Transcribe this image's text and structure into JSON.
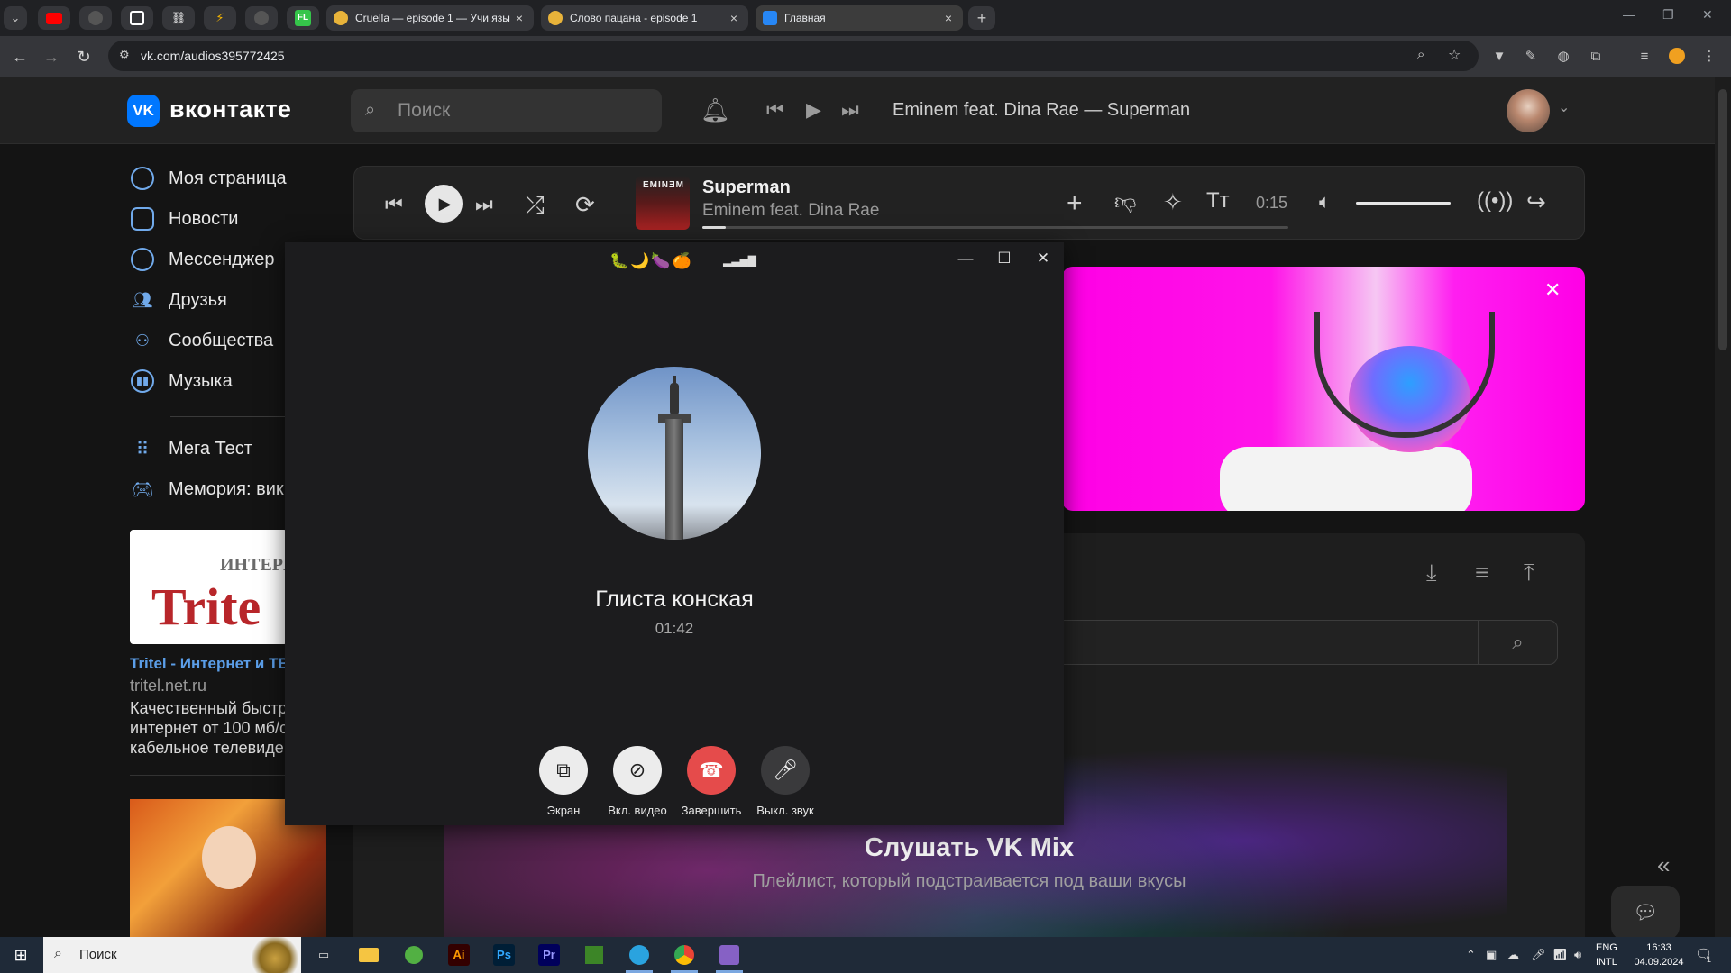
{
  "browser": {
    "tabs": [
      {
        "title": "Cruella — episode 1 — Учи язы",
        "close": "×"
      },
      {
        "title": "Слово пацана - episode 1",
        "close": "×"
      },
      {
        "title": "Главная",
        "close": "×"
      }
    ],
    "new_tab": "+",
    "url": "vk.com/audios395772425"
  },
  "vk": {
    "logo_text": "вконтакте",
    "search_placeholder": "Поиск",
    "header_track": "Eminem feat. Dina Rae — Superman",
    "sidebar": [
      {
        "label": "Моя страница",
        "icon": "user-icon"
      },
      {
        "label": "Новости",
        "icon": "news-icon"
      },
      {
        "label": "Мессенджер",
        "icon": "messenger-icon"
      },
      {
        "label": "Друзья",
        "icon": "friends-icon"
      },
      {
        "label": "Сообщества",
        "icon": "communities-icon"
      },
      {
        "label": "Музыка",
        "icon": "music-icon"
      },
      {
        "label": "Мега Тест",
        "icon": "apps-icon"
      },
      {
        "label": "Мемория: вик",
        "icon": "gamepad-icon"
      }
    ],
    "ad": {
      "logo_big": "Trite",
      "logo_small": "ИНТЕРН",
      "title": "Tritel - Интернет и ТВ",
      "host": "tritel.net.ru",
      "text_lines": [
        "Качественный быстр",
        "интернет от 100 мб/с",
        "кабельное телевиде"
      ]
    },
    "player": {
      "cover_label": "EMINƎM",
      "title": "Superman",
      "artist": "Eminem feat. Dina Rae",
      "time": "0:15",
      "progress_fraction": 0.04,
      "volume_fraction": 1.0
    },
    "audio_panel": {
      "mix_title": "Слушать VK Mix",
      "mix_subtitle": "Плейлист, который подстраивается под ваши вкусы"
    }
  },
  "call": {
    "status_emoji": "🐛🌙🍆🍊",
    "contact_name": "Глиста конская",
    "duration": "01:42",
    "buttons": [
      {
        "label": "Экран",
        "icon": "screen-share-icon"
      },
      {
        "label": "Вкл. видео",
        "icon": "video-off-icon"
      },
      {
        "label": "Завершить",
        "icon": "hang-up-icon"
      },
      {
        "label": "Выкл. звук",
        "icon": "microphone-icon"
      }
    ]
  },
  "taskbar": {
    "search_text": "Поиск",
    "lang_top": "ENG",
    "lang_bottom": "INTL",
    "time": "16:33",
    "date": "04.09.2024",
    "notif_count": "1",
    "apps": [
      {
        "label": "Ai",
        "color": "#330000",
        "fg": "#ff9a00"
      },
      {
        "label": "Ps",
        "color": "#001e36",
        "fg": "#31a8ff"
      },
      {
        "label": "Pr",
        "color": "#00005b",
        "fg": "#9999ff"
      }
    ]
  }
}
